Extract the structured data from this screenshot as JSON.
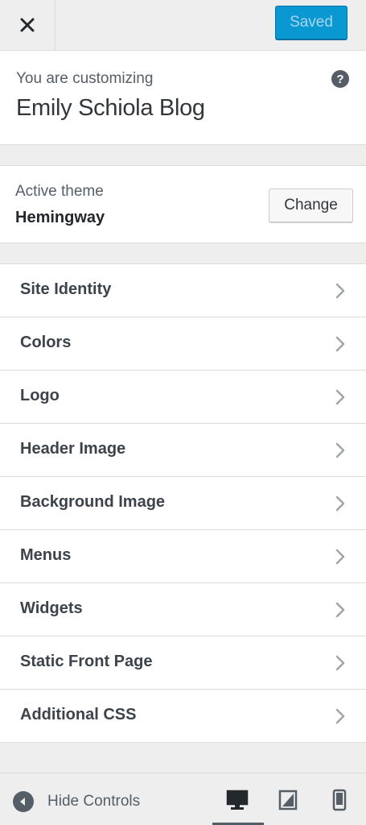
{
  "header": {
    "close_icon": "close-icon",
    "saved_label": "Saved"
  },
  "info": {
    "customizing_label": "You are customizing",
    "site_title": "Emily Schiola Blog",
    "help_glyph": "?"
  },
  "theme": {
    "active_label": "Active theme",
    "name": "Hemingway",
    "change_label": "Change"
  },
  "sections": [
    {
      "label": "Site Identity"
    },
    {
      "label": "Colors"
    },
    {
      "label": "Logo"
    },
    {
      "label": "Header Image"
    },
    {
      "label": "Background Image"
    },
    {
      "label": "Menus"
    },
    {
      "label": "Widgets"
    },
    {
      "label": "Static Front Page"
    },
    {
      "label": "Additional CSS"
    }
  ],
  "footer": {
    "hide_controls_label": "Hide Controls",
    "devices": [
      {
        "icon": "desktop-icon",
        "active": true
      },
      {
        "icon": "tablet-icon",
        "active": false
      },
      {
        "icon": "mobile-icon",
        "active": false
      }
    ]
  },
  "colors": {
    "accent": "#0a98d2",
    "background": "#eeeeee",
    "panel": "#ffffff",
    "text": "#3c434a"
  }
}
